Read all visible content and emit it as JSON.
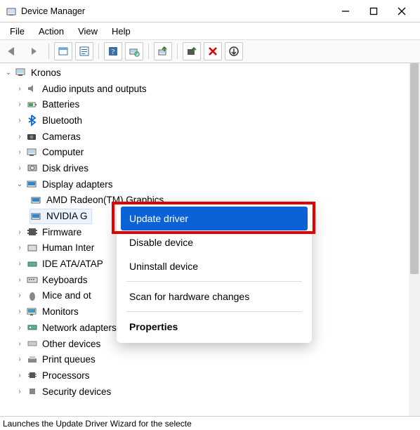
{
  "window": {
    "title": "Device Manager"
  },
  "menubar": {
    "file": "File",
    "action": "Action",
    "view": "View",
    "help": "Help"
  },
  "toolbar_icons": {
    "back": "back-arrow",
    "forward": "forward-arrow",
    "up": "show-hidden",
    "properties": "properties",
    "help": "help",
    "scan": "scan-hardware",
    "update": "update-driver",
    "disable": "disable-device",
    "uninstall": "uninstall-device",
    "legacy": "add-legacy"
  },
  "tree": {
    "root": "Kronos",
    "cats": [
      "Audio inputs and outputs",
      "Batteries",
      "Bluetooth",
      "Cameras",
      "Computer",
      "Disk drives",
      "Display adapters",
      "Firmware",
      "Human Inter",
      "IDE ATA/ATAP",
      "Keyboards",
      "Mice and ot",
      "Monitors",
      "Network adapters",
      "Other devices",
      "Print queues",
      "Processors",
      "Security devices"
    ],
    "display": {
      "amd": "AMD Radeon(TM) Graphics",
      "nvidia": "NVIDIA G"
    }
  },
  "context": {
    "update": "Update driver",
    "disable": "Disable device",
    "uninstall": "Uninstall device",
    "scan": "Scan for hardware changes",
    "props": "Properties"
  },
  "status": "Launches the Update Driver Wizard for the selecte"
}
